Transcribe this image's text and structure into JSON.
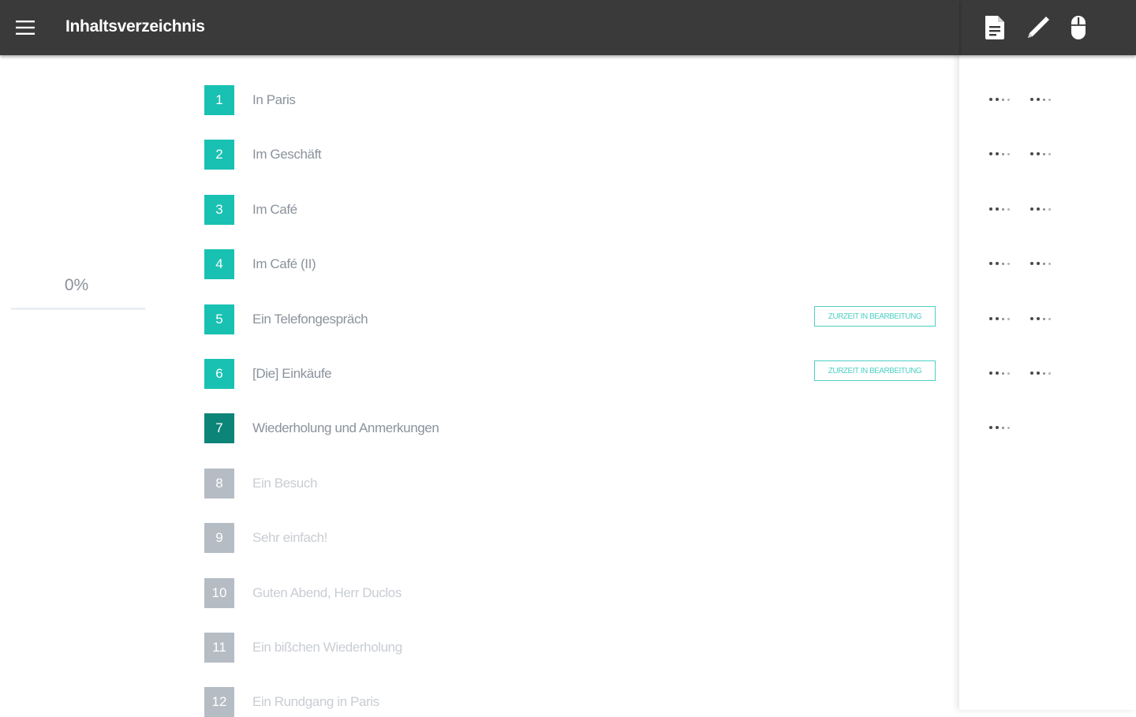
{
  "header": {
    "title": "Inhaltsverzeichnis"
  },
  "toolbar": {
    "icons": [
      "document-icon",
      "pencil-icon",
      "mouse-icon"
    ]
  },
  "progress": {
    "label": "0%",
    "value": 0
  },
  "colors": {
    "accent": "#19c1b2",
    "current": "#0d8478",
    "locked": "#b5bcc4",
    "topbar": "#3a3a3a"
  },
  "chapters": [
    {
      "number": "1",
      "title": "In Paris",
      "state": "done",
      "badge": "",
      "menus": 2
    },
    {
      "number": "2",
      "title": "Im Geschäft",
      "state": "done",
      "badge": "",
      "menus": 2
    },
    {
      "number": "3",
      "title": "Im Café",
      "state": "done",
      "badge": "",
      "menus": 2
    },
    {
      "number": "4",
      "title": "Im Café (II)",
      "state": "done",
      "badge": "",
      "menus": 2
    },
    {
      "number": "5",
      "title": "Ein Telefongespräch",
      "state": "done",
      "badge": "ZURZEIT IN BEARBEITUNG",
      "menus": 2
    },
    {
      "number": "6",
      "title": "[Die] Einkäufe",
      "state": "done",
      "badge": "ZURZEIT IN BEARBEITUNG",
      "menus": 2
    },
    {
      "number": "7",
      "title": "Wiederholung und Anmerkungen",
      "state": "current",
      "badge": "",
      "menus": 1
    },
    {
      "number": "8",
      "title": "Ein Besuch",
      "state": "locked",
      "badge": "",
      "menus": 0
    },
    {
      "number": "9",
      "title": "Sehr einfach!",
      "state": "locked",
      "badge": "",
      "menus": 0
    },
    {
      "number": "10",
      "title": "Guten Abend, Herr Duclos",
      "state": "locked",
      "badge": "",
      "menus": 0
    },
    {
      "number": "11",
      "title": "Ein bißchen Wiederholung",
      "state": "locked",
      "badge": "",
      "menus": 0
    },
    {
      "number": "12",
      "title": "Ein Rundgang in Paris",
      "state": "locked",
      "badge": "",
      "menus": 0
    }
  ]
}
